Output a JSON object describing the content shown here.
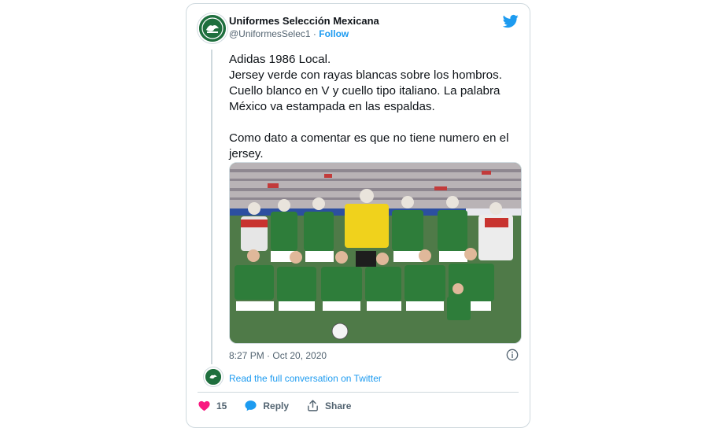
{
  "tweet": {
    "display_name": "Uniformes Selección Mexicana",
    "handle": "@UniformesSelec1",
    "separator": "·",
    "follow_label": "Follow",
    "text": "Adidas 1986 Local.\nJersey verde con rayas blancas sobre los hombros. Cuello blanco en V y cuello tipo italiano. La palabra México va estampada en las espaldas.\n\nComo dato a comentar es que no tiene numero en el jersey.",
    "timestamp": "8:27 PM · Oct 20, 2020",
    "read_more_label": "Read the full conversation on Twitter",
    "like_count": "15",
    "reply_label": "Reply",
    "share_label": "Share"
  },
  "photo": {
    "subject": "Mexico national football team squad photo, 1986 home kit",
    "kit_color": "#2e7d3a",
    "keeper_color": "#f0d21c",
    "grass_color": "#4f7a48"
  },
  "icons": {
    "brand": "twitter-bird-icon",
    "info": "info-icon",
    "like": "heart-icon",
    "reply": "reply-bubble-icon",
    "share": "share-upload-icon"
  },
  "colors": {
    "accent": "#1d9bf0",
    "like": "#f91880",
    "text": "#0f1419",
    "muted": "#536471",
    "border": "#cfd9de"
  }
}
